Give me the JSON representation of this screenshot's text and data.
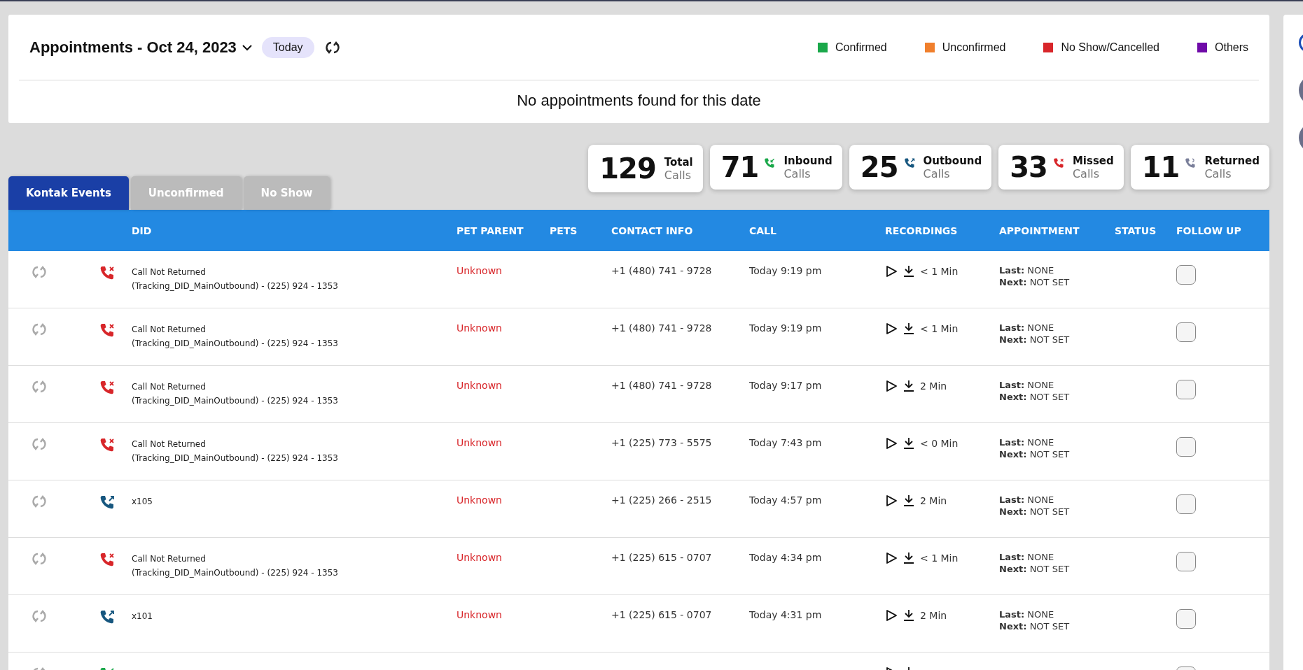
{
  "appointments": {
    "title": "Appointments - Oct 24, 2023",
    "today_button": "Today",
    "legend": [
      {
        "label": "Confirmed",
        "color": "#1aa84a"
      },
      {
        "label": "Unconfirmed",
        "color": "#f07f2c"
      },
      {
        "label": "No Show/Cancelled",
        "color": "#d8262a"
      },
      {
        "label": "Others",
        "color": "#6f0aa8"
      }
    ],
    "empty_message": "No appointments found for this date"
  },
  "tabs": [
    {
      "label": "Kontak Events",
      "selected": true
    },
    {
      "label": "Unconfirmed",
      "selected": false
    },
    {
      "label": "No Show",
      "selected": false
    }
  ],
  "stats": [
    {
      "kind": "total",
      "count": "129",
      "title": "Total",
      "unit": "Calls"
    },
    {
      "kind": "inbound",
      "count": "71",
      "title": "Inbound",
      "unit": "Calls"
    },
    {
      "kind": "outbound",
      "count": "25",
      "title": "Outbound",
      "unit": "Calls"
    },
    {
      "kind": "missed",
      "count": "33",
      "title": "Missed",
      "unit": "Calls"
    },
    {
      "kind": "returned",
      "count": "11",
      "title": "Returned",
      "unit": "Calls"
    }
  ],
  "table": {
    "columns": [
      "DID",
      "PET PARENT",
      "PETS",
      "CONTACT INFO",
      "CALL",
      "RECORDINGS",
      "APPOINTMENT",
      "STATUS",
      "FOLLOW UP"
    ],
    "rows": [
      {
        "kind": "missed",
        "did_title": "Call Not Returned",
        "did": "(Tracking_DID_MainOutbound) - (225) 924 - 1353",
        "pet_parent": "Unknown",
        "contact": "+1 (480) 741 - 9728",
        "call": "Today 9:19 pm",
        "duration": "< 1 Min",
        "last": "**Last:** NONE",
        "next": "**Next:** NOT SET",
        "follow_up": false
      },
      {
        "kind": "missed",
        "did_title": "Call Not Returned",
        "did": "(Tracking_DID_MainOutbound) - (225) 924 - 1353",
        "pet_parent": "Unknown",
        "contact": "+1 (480) 741 - 9728",
        "call": "Today 9:19 pm",
        "duration": "< 1 Min",
        "last": "**Last:** NONE",
        "next": "**Next:** NOT SET",
        "follow_up": false
      },
      {
        "kind": "missed",
        "did_title": "Call Not Returned",
        "did": "(Tracking_DID_MainOutbound) - (225) 924 - 1353",
        "pet_parent": "Unknown",
        "contact": "+1 (480) 741 - 9728",
        "call": "Today 9:17 pm",
        "duration": "2 Min",
        "last": "**Last:** NONE",
        "next": "**Next:** NOT SET",
        "follow_up": false
      },
      {
        "kind": "missed",
        "did_title": "Call Not Returned",
        "did": "(Tracking_DID_MainOutbound) - (225) 924 - 1353",
        "pet_parent": "Unknown",
        "contact": "+1 (225) 773 - 5575",
        "call": "Today 7:43 pm",
        "duration": "< 0 Min",
        "last": "**Last:** NONE",
        "next": "**Next:** NOT SET",
        "follow_up": false
      },
      {
        "kind": "outbound",
        "did": "x105",
        "pet_parent": "Unknown",
        "contact": "+1 (225) 266 - 2515",
        "call": "Today 4:57 pm",
        "duration": "2 Min",
        "last": "**Last:** NONE",
        "next": "**Next:** NOT SET",
        "follow_up": false
      },
      {
        "kind": "missed",
        "did_title": "Call Not Returned",
        "did": "(Tracking_DID_MainOutbound) - (225) 924 - 1353",
        "pet_parent": "Unknown",
        "contact": "+1 (225) 615 - 0707",
        "call": "Today 4:34 pm",
        "duration": "< 1 Min",
        "last": "**Last:** NONE",
        "next": "**Next:** NOT SET",
        "follow_up": false
      },
      {
        "kind": "outbound",
        "did": "x101",
        "pet_parent": "Unknown",
        "contact": "+1 (225) 615 - 0707",
        "call": "Today 4:31 pm",
        "duration": "2 Min",
        "last": "**Last:** NONE",
        "next": "**Next:** NOT SET",
        "follow_up": false
      },
      {
        "kind": "inbound",
        "follow_up": false
      }
    ]
  }
}
